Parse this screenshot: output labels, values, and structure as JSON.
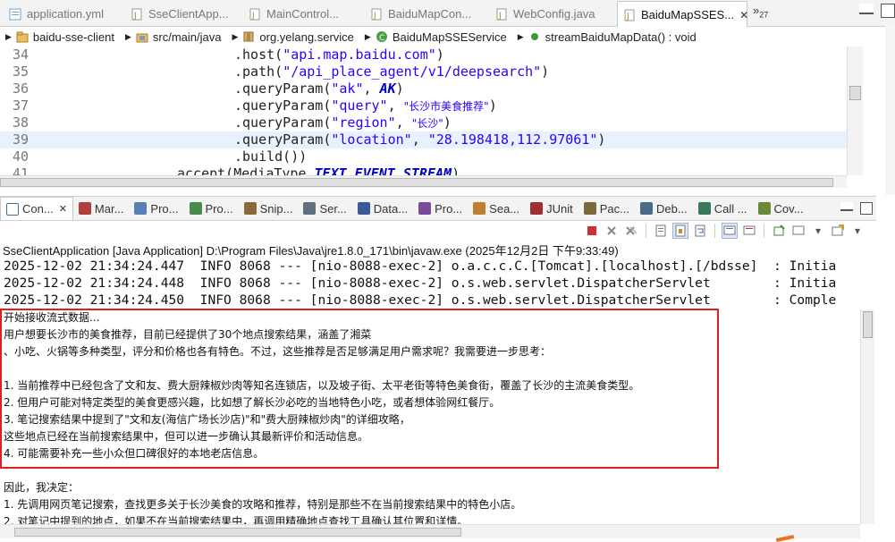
{
  "editor_tabs": [
    {
      "label": "application.yml",
      "active": false
    },
    {
      "label": "SseClientApp...",
      "active": false
    },
    {
      "label": "MainControl...",
      "active": false
    },
    {
      "label": "BaiduMapCon...",
      "active": false
    },
    {
      "label": "WebConfig.java",
      "active": false
    },
    {
      "label": "BaiduMapSSES...",
      "active": true
    }
  ],
  "overflow_count": "27",
  "breadcrumb": [
    "baidu-sse-client",
    "src/main/java",
    "org.yelang.service",
    "BaiduMapSSEService",
    "streamBaiduMapData() : void"
  ],
  "code_lines": [
    {
      "num": "34",
      "parts": [
        ".host(",
        "\"api.map.baidu.com\"",
        ")"
      ]
    },
    {
      "num": "35",
      "parts": [
        ".path(",
        "\"/api_place_agent/v1/deepsearch\"",
        ")"
      ]
    },
    {
      "num": "36",
      "parts": [
        ".queryParam(",
        "\"ak\"",
        ", ",
        "AK",
        ")"
      ]
    },
    {
      "num": "37",
      "parts": [
        ".queryParam(",
        "\"query\"",
        ", ",
        "\"长沙市美食推荐\"",
        ")"
      ]
    },
    {
      "num": "38",
      "parts": [
        ".queryParam(",
        "\"region\"",
        ", ",
        "\"长沙\"",
        ")"
      ]
    },
    {
      "num": "39",
      "parts": [
        ".queryParam(",
        "\"location\"",
        ", ",
        "\"28.198418,112.97061\"",
        ")"
      ]
    },
    {
      "num": "40",
      "parts": [
        ".build())"
      ]
    },
    {
      "num": "41",
      "parts": [
        "accept(MediaType.",
        "TEXT_EVENT_STREAM",
        ")"
      ]
    }
  ],
  "view_tabs": [
    {
      "label": "Con...",
      "active": true,
      "icon": "console-icon",
      "color": "#3a6ea5"
    },
    {
      "label": "Mar...",
      "active": false,
      "icon": "markers-icon",
      "color": "#b04040"
    },
    {
      "label": "Pro...",
      "active": false,
      "icon": "properties-icon",
      "color": "#5a7fb5"
    },
    {
      "label": "Pro...",
      "active": false,
      "icon": "progress-icon",
      "color": "#4a8a4a"
    },
    {
      "label": "Snip...",
      "active": false,
      "icon": "snippets-icon",
      "color": "#8a6a3a"
    },
    {
      "label": "Ser...",
      "active": false,
      "icon": "servers-icon",
      "color": "#607080"
    },
    {
      "label": "Data...",
      "active": false,
      "icon": "data-source-icon",
      "color": "#3a5a9a"
    },
    {
      "label": "Pro...",
      "active": false,
      "icon": "problems-icon",
      "color": "#7a4a9a"
    },
    {
      "label": "Sea...",
      "active": false,
      "icon": "search-icon",
      "color": "#c08030"
    },
    {
      "label": "JUnit",
      "active": false,
      "icon": "junit-icon",
      "color": "#a03030"
    },
    {
      "label": "Pac...",
      "active": false,
      "icon": "package-explorer-icon",
      "color": "#7a6a3a"
    },
    {
      "label": "Deb...",
      "active": false,
      "icon": "debug-icon",
      "color": "#4a6a8a"
    },
    {
      "label": "Call ...",
      "active": false,
      "icon": "call-hierarchy-icon",
      "color": "#3a7a5a"
    },
    {
      "label": "Cov...",
      "active": false,
      "icon": "coverage-icon",
      "color": "#6a8a3a"
    }
  ],
  "console_header": "SseClientApplication [Java Application] D:\\Program Files\\Java\\jre1.8.0_171\\bin\\javaw.exe (2025年12月2日 下午9:33:49)",
  "log_lines": [
    "2025-12-02 21:34:24.447  INFO 8068 --- [nio-8088-exec-2] o.a.c.c.C.[Tomcat].[localhost].[/bdsse]  : Initia",
    "2025-12-02 21:34:24.448  INFO 8068 --- [nio-8088-exec-2] o.s.web.servlet.DispatcherServlet        : Initia",
    "2025-12-02 21:34:24.450  INFO 8068 --- [nio-8088-exec-2] o.s.web.servlet.DispatcherServlet        : Comple"
  ],
  "stream_lines": [
    "开始接收流式数据...",
    "用户想要长沙市的美食推荐，目前已经提供了30个地点搜索结果，涵盖了湘菜",
    "、小吃、火锅等多种类型，评分和价格也各有特色。不过，这些推荐是否足够满足用户需求呢？我需要进一步思考：",
    "",
    "1. 当前推荐中已经包含了文和友、费大厨辣椒炒肉等知名连锁店，以及坡子街、太平老街等特色美食街，覆盖了长沙的主流美食类型。",
    "2. 但用户可能对特定类型的美食更感兴趣，比如想了解长沙必吃的当地特色小吃，或者想体验网红餐厅。",
    "3. 笔记搜索结果中提到了\"文和友(海信广场长沙店)\"和\"费大厨辣椒炒肉\"的详细攻略，",
    "这些地点已经在当前搜索结果中，但可以进一步确认其最新评价和活动信息。",
    "4. 可能需要补充一些小众但口碑很好的本地老店信息。",
    "",
    "因此，我决定：",
    "1. 先调用网页笔记搜索，查找更多关于长沙美食的攻略和推荐，特别是那些不在当前搜索结果中的特色小店。",
    "2. 对笔记中提到的地点，如果不在当前搜索结果中，再调用精确地点查找工具确认其位置和详情。"
  ],
  "colors": {
    "highlight": "#e8f2fe",
    "redbox": "#e02020",
    "string": "#2a00ff",
    "constant": "#0000c0"
  }
}
